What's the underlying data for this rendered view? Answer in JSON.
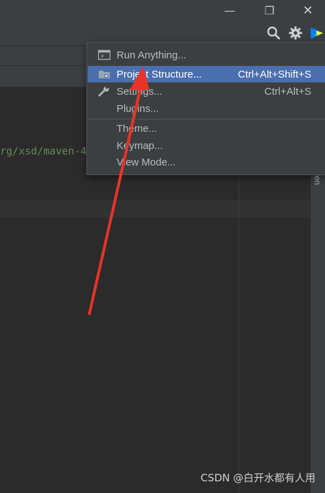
{
  "window_controls": {
    "minimize_glyph": "—",
    "restore_glyph": "❐",
    "close_glyph": "✕"
  },
  "toolbar": {
    "icons": [
      "search-icon",
      "gear-icon",
      "plugin-logo-icon"
    ]
  },
  "editor": {
    "code_line": "rg/xsd/maven-4"
  },
  "side_panel": {
    "label": "ven"
  },
  "menu": {
    "items": [
      {
        "label": "Run Anything...",
        "shortcut": "",
        "icon": "run-anything-icon"
      },
      {
        "label": "Project Structure...",
        "shortcut": "Ctrl+Alt+Shift+S",
        "icon": "project-structure-icon",
        "selected": true
      },
      {
        "label": "Settings...",
        "shortcut": "Ctrl+Alt+S",
        "icon": "wrench-icon"
      },
      {
        "label": "Plugins...",
        "shortcut": ""
      },
      {
        "label": "Theme...",
        "shortcut": ""
      },
      {
        "label": "Keymap...",
        "shortcut": ""
      },
      {
        "label": "View Mode...",
        "shortcut": ""
      }
    ]
  },
  "colors": {
    "background": "#2b2b2b",
    "panel": "#3c3f41",
    "selection": "#4b6eaf",
    "arrow": "#e8332a",
    "string_green": "#6a8759"
  },
  "watermark": "CSDN @白开水都有人用"
}
